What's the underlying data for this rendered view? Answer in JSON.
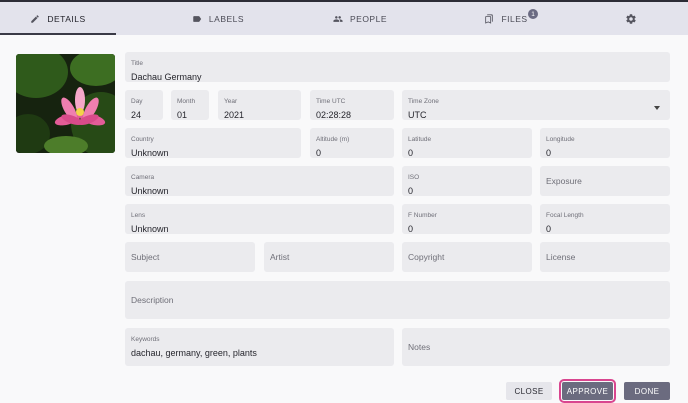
{
  "tabs": [
    {
      "label": "DETAILS",
      "icon": "pencil-icon"
    },
    {
      "label": "LABELS",
      "icon": "label-icon"
    },
    {
      "label": "PEOPLE",
      "icon": "people-icon"
    },
    {
      "label": "FILES",
      "icon": "files-icon",
      "badge": "1"
    },
    {
      "label": "",
      "icon": "gear-icon"
    }
  ],
  "photo": {
    "alt": "pink water lily"
  },
  "fields": {
    "title": {
      "label": "Title",
      "value": "Dachau Germany"
    },
    "day": {
      "label": "Day",
      "value": "24"
    },
    "month": {
      "label": "Month",
      "value": "01"
    },
    "year": {
      "label": "Year",
      "value": "2021"
    },
    "time_utc": {
      "label": "Time UTC",
      "value": "02:28:28"
    },
    "time_zone": {
      "label": "Time Zone",
      "value": "UTC"
    },
    "country": {
      "label": "Country",
      "value": "Unknown"
    },
    "altitude": {
      "label": "Altitude (m)",
      "value": "0"
    },
    "latitude": {
      "label": "Latitude",
      "value": "0"
    },
    "longitude": {
      "label": "Longitude",
      "value": "0"
    },
    "camera": {
      "label": "Camera",
      "value": "Unknown"
    },
    "iso": {
      "label": "ISO",
      "value": "0"
    },
    "exposure": {
      "placeholder": "Exposure"
    },
    "lens": {
      "label": "Lens",
      "value": "Unknown"
    },
    "f_number": {
      "label": "F Number",
      "value": "0"
    },
    "focal_length": {
      "label": "Focal Length",
      "value": "0"
    },
    "subject": {
      "placeholder": "Subject"
    },
    "artist": {
      "placeholder": "Artist"
    },
    "copyright": {
      "placeholder": "Copyright"
    },
    "license": {
      "placeholder": "License"
    },
    "description": {
      "placeholder": "Description"
    },
    "keywords": {
      "label": "Keywords",
      "value": "dachau, germany, green, plants"
    },
    "notes": {
      "placeholder": "Notes"
    }
  },
  "buttons": {
    "close": "CLOSE",
    "approve": "APPROVE",
    "done": "DONE"
  }
}
